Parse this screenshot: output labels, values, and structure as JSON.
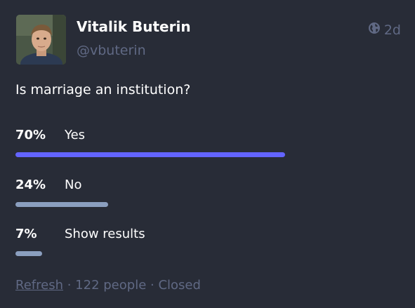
{
  "author": {
    "display_name": "Vitalik Buterin",
    "handle": "@vbuterin",
    "avatar_icon": "user-avatar"
  },
  "meta": {
    "visibility_icon": "globe-icon",
    "relative_time": "2d"
  },
  "poll": {
    "question": "Is marriage an institution?",
    "options": [
      {
        "percent_label": "70%",
        "label": "Yes",
        "fraction": 0.7,
        "leading": true
      },
      {
        "percent_label": "24%",
        "label": "No",
        "fraction": 0.24,
        "leading": false
      },
      {
        "percent_label": "7%",
        "label": "Show results",
        "fraction": 0.07,
        "leading": false
      }
    ],
    "footer": {
      "refresh_label": "Refresh",
      "separator": "·",
      "voters": "122 people",
      "status": "Closed"
    }
  },
  "colors": {
    "background": "#282c37",
    "muted": "#606984",
    "leading_bar": "#6364ff",
    "other_bar": "#8b9fbf"
  }
}
